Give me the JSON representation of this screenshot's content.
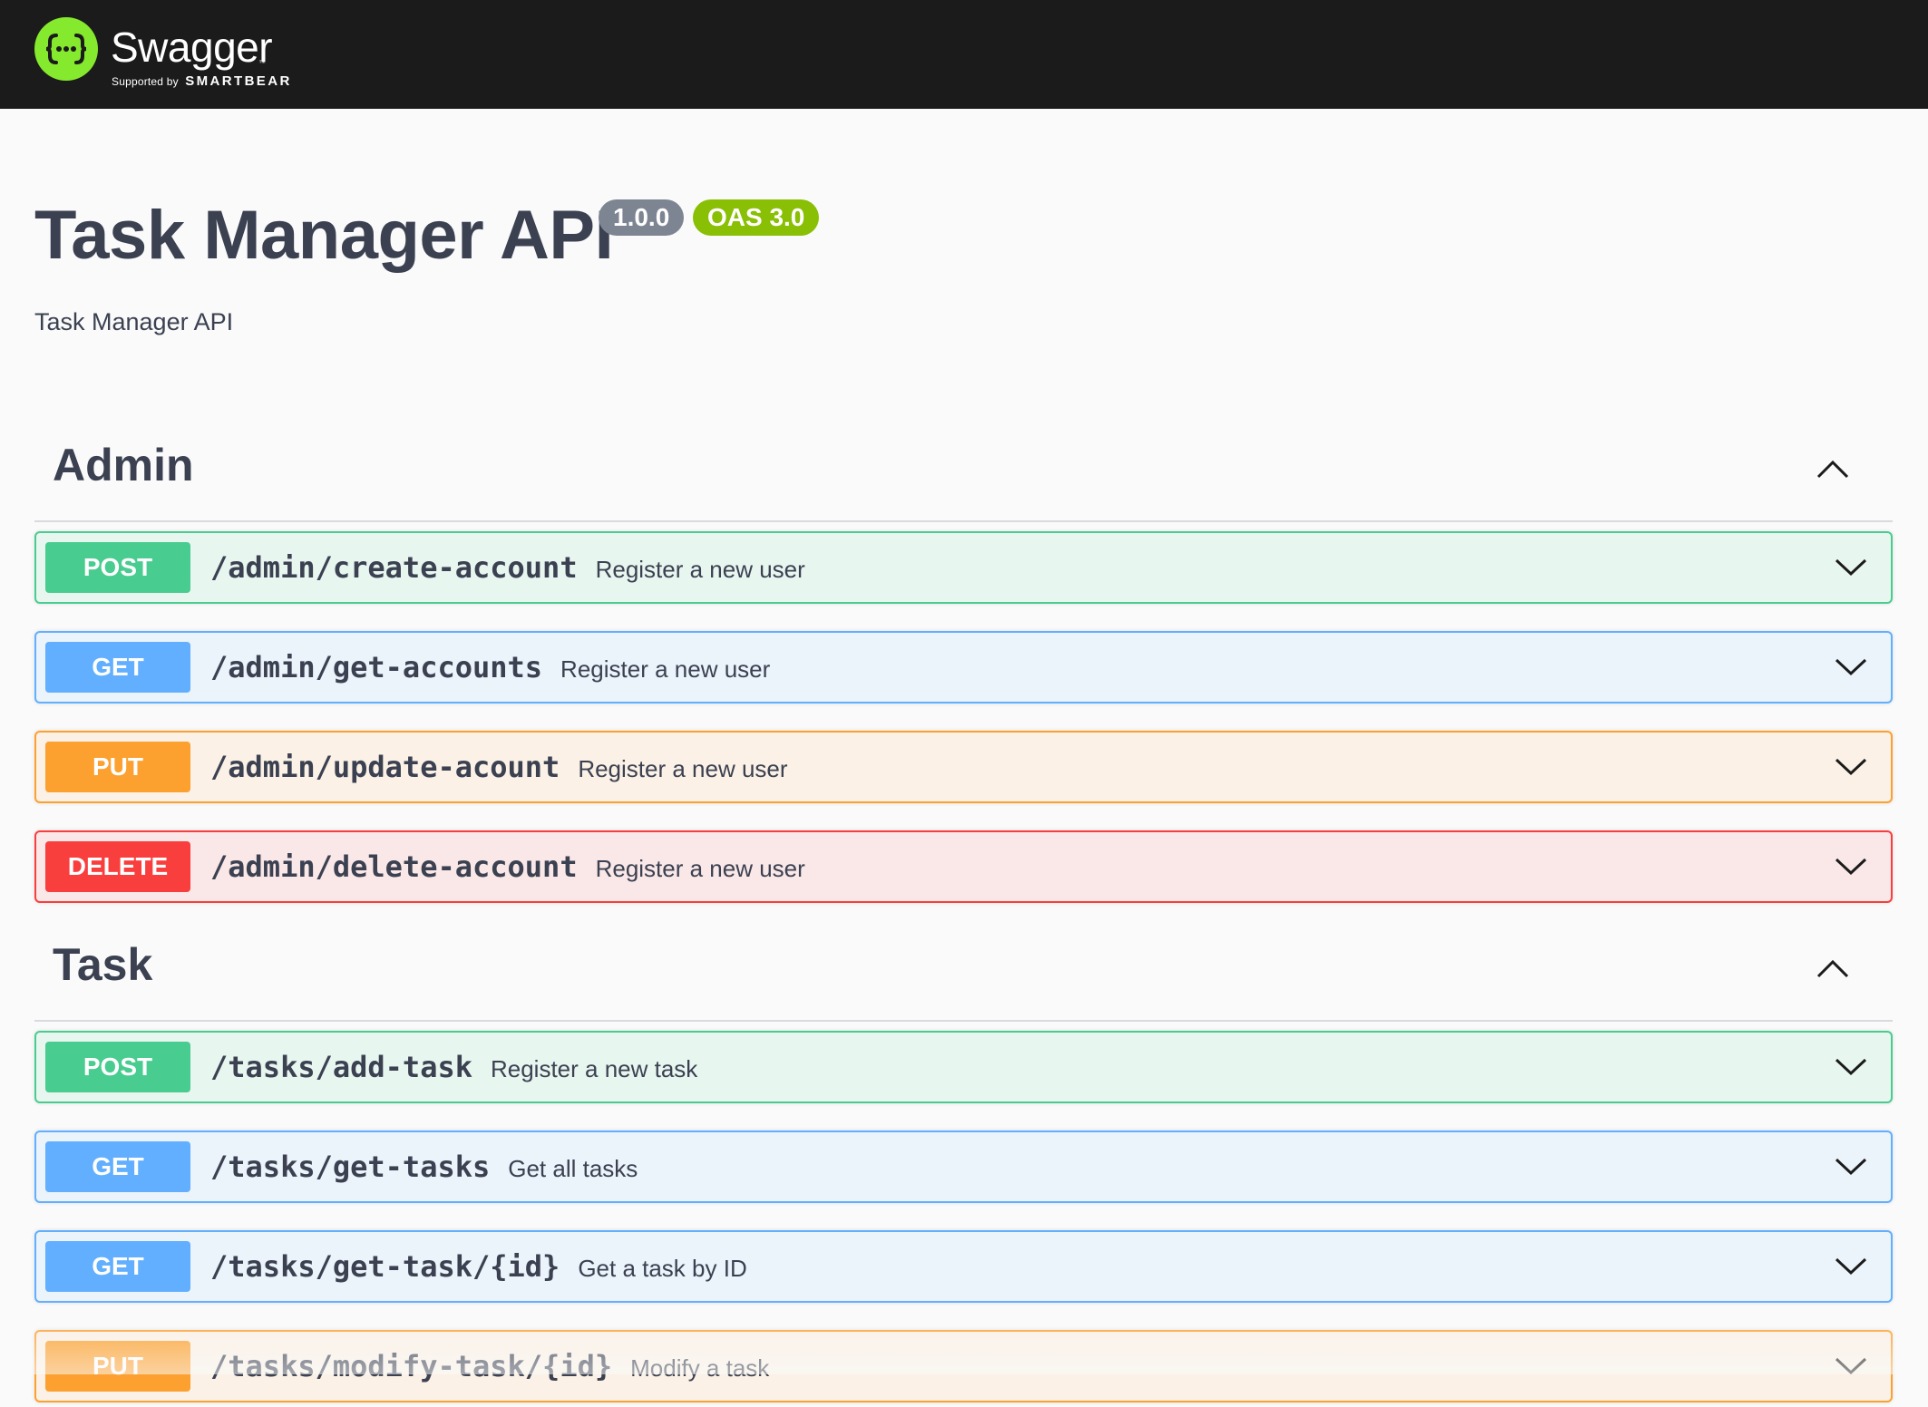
{
  "topbar": {
    "brand_name": "Swagger",
    "brand_tm": "™",
    "supported_by": "Supported by",
    "supporter": "SMARTBEAR",
    "logo_icon": "swagger-braces-icon",
    "colors": {
      "background": "#1b1b1b",
      "logo": "#85ea2d"
    }
  },
  "info": {
    "title": "Task Manager API",
    "version": "1.0.0",
    "oas": "OAS 3.0",
    "description": "Task Manager API"
  },
  "method_colors": {
    "POST": "#49cc90",
    "GET": "#61affe",
    "PUT": "#fca130",
    "DELETE": "#f93e3e"
  },
  "tags": [
    {
      "name": "Admin",
      "expanded": true,
      "operations": [
        {
          "method": "POST",
          "path": "/admin/create-account",
          "summary": "Register a new user"
        },
        {
          "method": "GET",
          "path": "/admin/get-accounts",
          "summary": "Register a new user"
        },
        {
          "method": "PUT",
          "path": "/admin/update-acount",
          "summary": "Register a new user"
        },
        {
          "method": "DELETE",
          "path": "/admin/delete-account",
          "summary": "Register a new user"
        }
      ]
    },
    {
      "name": "Task",
      "expanded": true,
      "operations": [
        {
          "method": "POST",
          "path": "/tasks/add-task",
          "summary": "Register a new task"
        },
        {
          "method": "GET",
          "path": "/tasks/get-tasks",
          "summary": "Get all tasks"
        },
        {
          "method": "GET",
          "path": "/tasks/get-task/{id}",
          "summary": "Get a task by ID"
        },
        {
          "method": "PUT",
          "path": "/tasks/modify-task/{id}",
          "summary": "Modify a task"
        }
      ]
    }
  ]
}
